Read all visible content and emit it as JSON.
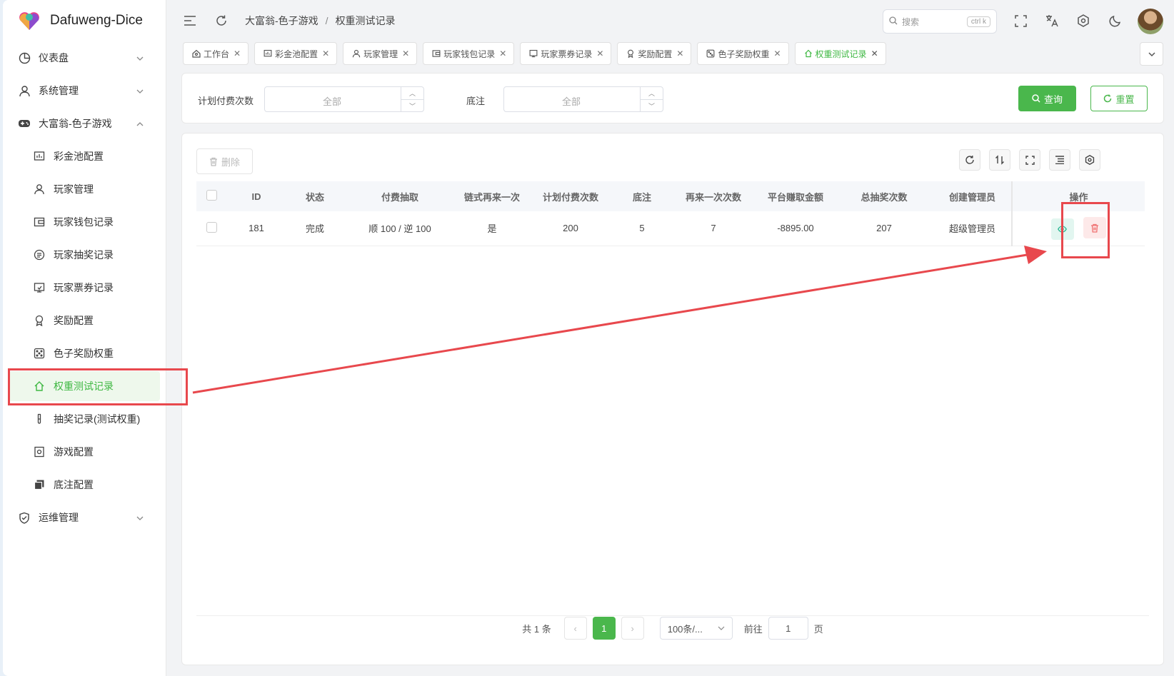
{
  "app": {
    "title": "Dafuweng-Dice"
  },
  "sidebar": {
    "items": [
      {
        "label": "仪表盘",
        "icon": "pie-chart-icon",
        "expandable": true
      },
      {
        "label": "系统管理",
        "icon": "user-icon",
        "expandable": true
      },
      {
        "label": "大富翁-色子游戏",
        "icon": "gamepad-icon",
        "expandable": true,
        "expanded": true
      }
    ],
    "submenu": [
      {
        "label": "彩金池配置",
        "icon": "bar-chart-icon"
      },
      {
        "label": "玩家管理",
        "icon": "user-icon"
      },
      {
        "label": "玩家钱包记录",
        "icon": "wallet-icon"
      },
      {
        "label": "玩家抽奖记录",
        "icon": "lottery-icon"
      },
      {
        "label": "玩家票券记录",
        "icon": "ticket-icon"
      },
      {
        "label": "奖励配置",
        "icon": "award-icon"
      },
      {
        "label": "色子奖励权重",
        "icon": "dice-icon"
      },
      {
        "label": "权重测试记录",
        "icon": "home-icon",
        "active": true
      },
      {
        "label": "抽奖记录(测试权重)",
        "icon": "test-tube-icon"
      },
      {
        "label": "游戏配置",
        "icon": "settings-doc-icon"
      },
      {
        "label": "底注配置",
        "icon": "copy-icon"
      }
    ],
    "footer_item": {
      "label": "运维管理",
      "icon": "shield-icon",
      "expandable": true
    }
  },
  "header": {
    "breadcrumb": [
      "大富翁-色子游戏",
      "权重测试记录"
    ],
    "search": {
      "placeholder": "搜索",
      "shortcut": "ctrl k"
    }
  },
  "tabs": [
    {
      "label": "工作台",
      "icon": "workbench-icon"
    },
    {
      "label": "彩金池配置",
      "icon": "bar-chart-icon"
    },
    {
      "label": "玩家管理",
      "icon": "user-icon"
    },
    {
      "label": "玩家钱包记录",
      "icon": "wallet-icon"
    },
    {
      "label": "玩家票券记录",
      "icon": "ticket-icon"
    },
    {
      "label": "奖励配置",
      "icon": "award-icon"
    },
    {
      "label": "色子奖励权重",
      "icon": "dice-icon"
    },
    {
      "label": "权重测试记录",
      "icon": "home-icon",
      "active": true
    }
  ],
  "filter": {
    "field1_label": "计划付费次数",
    "field1_placeholder": "全部",
    "field2_label": "底注",
    "field2_placeholder": "全部",
    "query_label": "查询",
    "reset_label": "重置"
  },
  "toolbar": {
    "delete_label": "删除"
  },
  "table": {
    "columns": [
      "ID",
      "状态",
      "付费抽取",
      "链式再来一次",
      "计划付费次数",
      "底注",
      "再来一次次数",
      "平台赚取金额",
      "总抽奖次数",
      "创建管理员",
      "操作"
    ],
    "rows": [
      [
        "181",
        "完成",
        "顺 100 / 逆 100",
        "是",
        "200",
        "5",
        "7",
        "-8895.00",
        "207",
        "超级管理员"
      ]
    ]
  },
  "pagination": {
    "total_label": "共 1 条",
    "current_page": "1",
    "page_size": "100条/...",
    "goto_label": "前往",
    "goto_value": "1",
    "page_suffix": "页"
  },
  "colors": {
    "accent": "#4ab74c",
    "annotation": "#e8484d"
  }
}
